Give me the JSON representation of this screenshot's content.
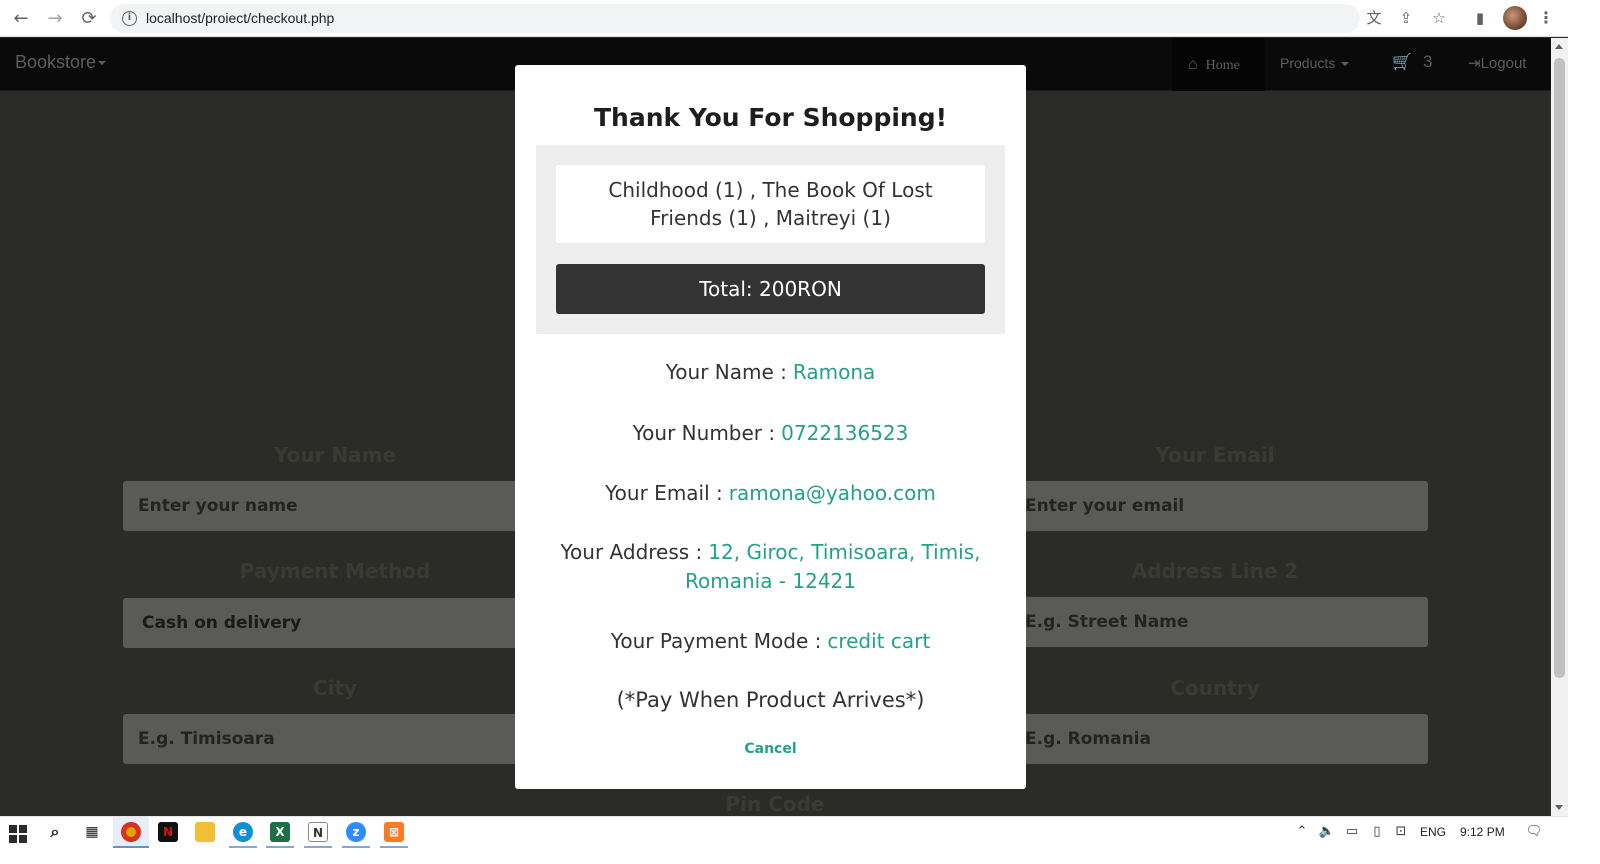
{
  "browser": {
    "url": "localhost/proiect/checkout.php",
    "back_icon": "←",
    "forward_icon": "→",
    "reload_icon": "⟳"
  },
  "navbar": {
    "brand": "Bookstore",
    "home_label": "Home",
    "products_label": "Products",
    "cart_count": "3",
    "logout_label": "Logout"
  },
  "form": {
    "name_label": "Your Name",
    "name_placeholder": "Enter your name",
    "email_label": "Your Email",
    "email_placeholder": "Enter your email",
    "payment_label": "Payment Method",
    "payment_value": "Cash on delivery",
    "address2_label": "Address Line 2",
    "address2_placeholder": "E.g. Street Name",
    "city_label": "City",
    "city_placeholder": "E.g. Timisoara",
    "country_label": "Country",
    "country_placeholder": "E.g. Romania",
    "pin_label": "Pin Code"
  },
  "modal": {
    "title": "Thank You For Shopping!",
    "products": "Childhood (1) , The Book Of Lost Friends (1) , Maitreyi (1)",
    "total": "Total: 200RON",
    "name_key": "Your Name :",
    "name_value": "Ramona",
    "number_key": "Your Number :",
    "number_value": "0722136523",
    "email_key": "Your Email :",
    "email_value": "ramona@yahoo.com",
    "address_key": "Your Address :",
    "address_value": "12, Giroc, Timisoara, Timis, Romania - 12421",
    "payment_key": "Your Payment Mode :",
    "payment_value": "credit cart",
    "pay_note": "(*Pay When Product Arrives*)",
    "cancel_label": "Cancel"
  },
  "taskbar": {
    "language": "ENG",
    "time": "9:12 PM"
  },
  "colors": {
    "accent": "#23a18a",
    "total_bg": "#333333",
    "navbar_bg": "#0a0a0a"
  }
}
